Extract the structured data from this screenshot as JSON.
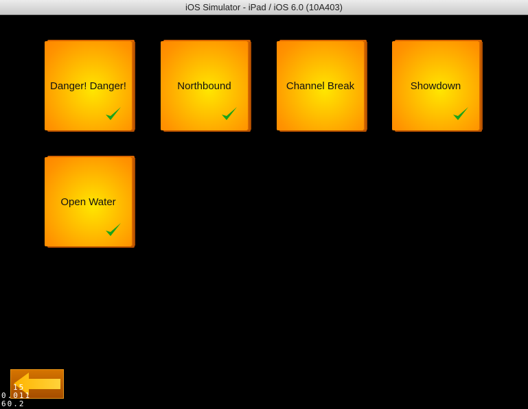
{
  "window": {
    "title": "iOS Simulator - iPad / iOS 6.0 (10A403)"
  },
  "levels": [
    {
      "label": "Danger! Danger!",
      "completed": true
    },
    {
      "label": "Northbound",
      "completed": true
    },
    {
      "label": "Channel Break",
      "completed": false
    },
    {
      "label": "Showdown",
      "completed": true
    },
    {
      "label": "Open Water",
      "completed": true
    }
  ],
  "back_button": {
    "icon": "arrow-left-icon"
  },
  "debug_stats": {
    "line1": "15",
    "line2": "0.011",
    "line3": "60.2"
  },
  "colors": {
    "tile_center": "#ffe600",
    "tile_edge": "#ff8600",
    "check": "#1aa31a",
    "background": "#000000"
  }
}
